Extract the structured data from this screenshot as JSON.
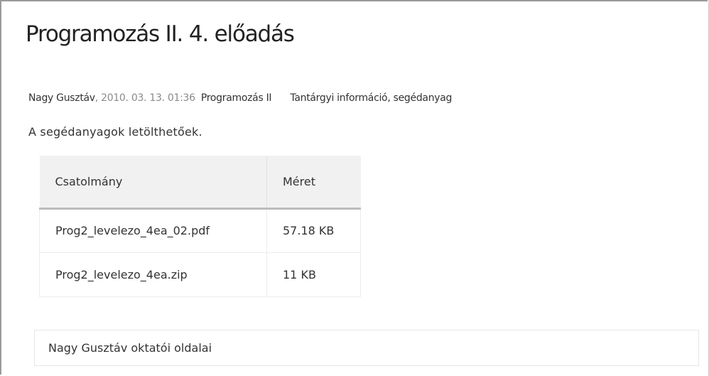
{
  "article": {
    "title": "Programozás II. 4. előadás",
    "author": "Nagy Gusztáv",
    "date": "2010. 03. 13. 01:36",
    "tags": [
      "Programozás II",
      "Tantárgyi információ, segédanyag"
    ],
    "body": "A segédanyagok letölthetőek."
  },
  "attachments": {
    "headers": {
      "name": "Csatolmány",
      "size": "Méret"
    },
    "rows": [
      {
        "name": "Prog2_levelezo_4ea_02.pdf",
        "size": "57.18 KB"
      },
      {
        "name": "Prog2_levelezo_4ea.zip",
        "size": "11 KB"
      }
    ]
  },
  "footer": {
    "link": "Nagy Gusztáv oktatói oldalai"
  }
}
